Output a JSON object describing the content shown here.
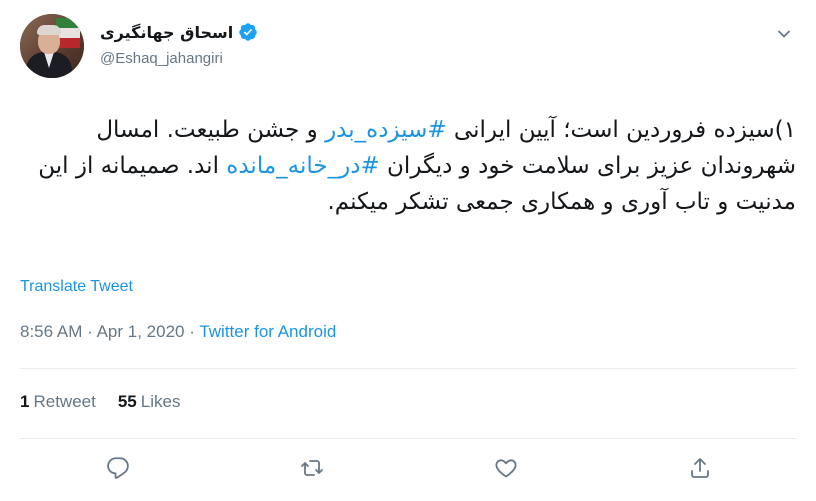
{
  "author": {
    "display_name": "اسحاق جهانگیری",
    "handle": "@Eshaq_jahangiri",
    "verified": true,
    "avatar_icon": "avatar-photo"
  },
  "tweet": {
    "text_part1": "۱)سیزده فروردین است؛ آیین ایرانی ",
    "hashtag1": "#سیزده_بدر",
    "text_part2": " و جشن طبیعت. امسال شهروندان عزیز برای سلامت خود و دیگران ",
    "hashtag2": "#در_خانه_مانده",
    "text_part3": " اند. صمیمانه از این مدنیت و تاب آوری و همکاری جمعی تشکر میکنم."
  },
  "translate_label": "Translate Tweet",
  "meta": {
    "time": "8:56 AM",
    "date": "Apr 1, 2020",
    "separator": "·",
    "source": "Twitter for Android"
  },
  "stats": {
    "retweets_count": "1",
    "retweets_label": "Retweet",
    "likes_count": "55",
    "likes_label": "Likes"
  },
  "actions": {
    "reply_icon": "reply-icon",
    "retweet_icon": "retweet-icon",
    "like_icon": "heart-icon",
    "share_icon": "share-icon"
  },
  "colors": {
    "link": "#1b95e0",
    "muted": "#657786",
    "text": "#14171a",
    "divider": "#e6ecf0"
  }
}
